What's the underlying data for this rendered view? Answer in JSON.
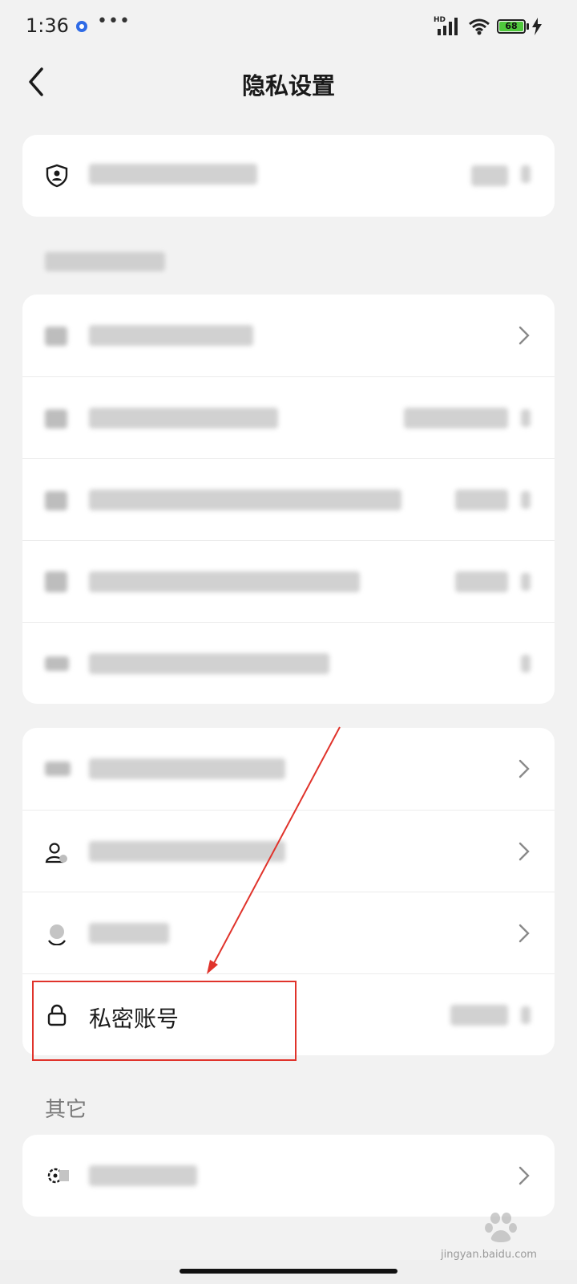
{
  "status_bar": {
    "time": "1:36",
    "more": "•••",
    "network_badge": "HD",
    "battery_level": "68",
    "battery_color": "#4fc93c"
  },
  "header": {
    "title": "隐私设置"
  },
  "card_top": {
    "rows": [
      {
        "icon": "shield-person-icon",
        "label": "",
        "value": ""
      }
    ]
  },
  "section1": {
    "title": ""
  },
  "card_account": {
    "rows": [
      {
        "icon": "person-icon",
        "label": "",
        "value": ""
      },
      {
        "icon": "person-icon",
        "label": "",
        "value": ""
      },
      {
        "icon": "person-icon",
        "label": "",
        "value": ""
      },
      {
        "icon": "person-icon",
        "label": "",
        "value": ""
      },
      {
        "icon": "list-icon",
        "label": "",
        "value": ""
      }
    ]
  },
  "card_privacy": {
    "rows": [
      {
        "icon": "eye-icon",
        "label": "",
        "value": ""
      },
      {
        "icon": "person-block-icon",
        "label": "",
        "value": ""
      },
      {
        "icon": "blacklist-icon",
        "label": "",
        "value": ""
      },
      {
        "icon": "lock-icon",
        "label": "私密账号",
        "value": ""
      }
    ]
  },
  "section_other": {
    "title": "其它"
  },
  "card_other": {
    "rows": [
      {
        "icon": "gear-icon",
        "label": "",
        "value": ""
      }
    ]
  },
  "annotation": {
    "color": "#e0332b"
  },
  "watermark": {
    "text": "jingyan.baidu.com"
  }
}
